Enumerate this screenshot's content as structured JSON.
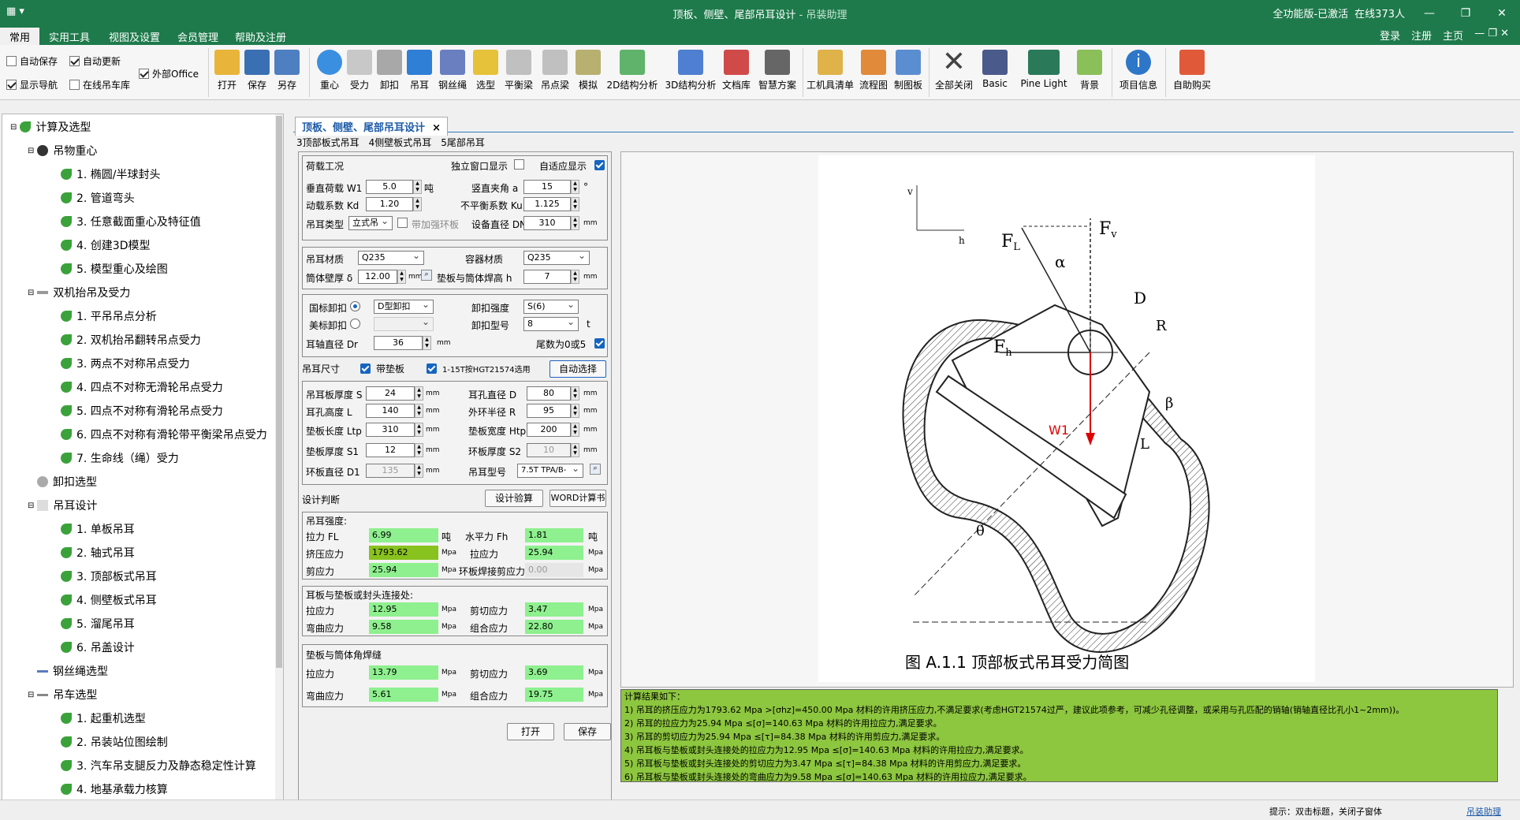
{
  "titlebar": {
    "title": "顶板、侧壁、尾部吊耳设计",
    "app": " - 吊装助理",
    "status": "全功能版-已激活",
    "online": "在线373人"
  },
  "menu": {
    "items": [
      "常用",
      "实用工具",
      "视图及设置",
      "会员管理",
      "帮助及注册"
    ],
    "right": [
      "登录",
      "注册",
      "主页"
    ]
  },
  "ribbon": {
    "checks": [
      {
        "label": "自动保存",
        "on": false
      },
      {
        "label": "自动更新",
        "on": true
      },
      {
        "label": "外部Office",
        "on": true
      },
      {
        "label": "显示导航",
        "on": true
      },
      {
        "label": "在线吊车库",
        "on": false
      }
    ],
    "buttons": [
      "打开",
      "保存",
      "另存",
      "重心",
      "受力",
      "卸扣",
      "吊耳",
      "钢丝绳",
      "选型",
      "平衡梁",
      "吊点梁",
      "模拟",
      "2D结构分析",
      "3D结构分析",
      "文档库",
      "智慧方案",
      "工机具清单",
      "流程图",
      "制图板",
      "全部关闭",
      "Basic",
      "Pine Light",
      "背景",
      "项目信息",
      "自助购买"
    ]
  },
  "tree": {
    "root": "计算及选型",
    "g1": "吊物重心",
    "g1_items": [
      "1. 椭圆/半球封头",
      "2. 管道弯头",
      "3. 任意截面重心及特征值",
      "4. 创建3D模型",
      "5. 模型重心及绘图"
    ],
    "g2": "双机抬吊及受力",
    "g2_items": [
      "1. 平吊吊点分析",
      "2. 双机抬吊翻转吊点受力",
      "3. 两点不对称吊点受力",
      "4. 四点不对称无滑轮吊点受力",
      "5. 四点不对称有滑轮吊点受力",
      "6. 四点不对称有滑轮带平衡梁吊点受力",
      "7. 生命线（绳）受力"
    ],
    "g3": "卸扣选型",
    "g4": "吊耳设计",
    "g4_items": [
      "1. 单板吊耳",
      "2. 轴式吊耳",
      "3. 顶部板式吊耳",
      "4. 侧壁板式吊耳",
      "5. 溜尾吊耳",
      "6. 吊盖设计"
    ],
    "g5": "钢丝绳选型",
    "g6": "吊车选型",
    "g6_items": [
      "1. 起重机选型",
      "2. 吊装站位图绘制",
      "3. 汽车吊支腿反力及静态稳定性计算",
      "4. 地基承载力核算"
    ]
  },
  "doc": {
    "tab": "顶板、侧壁、尾部吊耳设计",
    "subtabs": [
      "3顶部板式吊耳",
      "4侧壁板式吊耳",
      "5尾部吊耳"
    ]
  },
  "form": {
    "load_title": "荷载工况",
    "indep": "独立窗口显示",
    "adapt": "自适应显示",
    "w1_lbl": "垂直荷载 W1",
    "w1": "5.0",
    "w1_unit": "吨",
    "angle_lbl": "竖直夹角 a",
    "angle": "15",
    "angle_unit": "°",
    "kd_lbl": "动载系数 Kd",
    "kd": "1.20",
    "ku_lbl": "不平衡系数 Ku",
    "ku": "1.125",
    "type_lbl": "吊耳类型",
    "type": "立式吊",
    "ring_lbl": "带加强环板",
    "dn_lbl": "设备直径 DN",
    "dn": "310",
    "dn_unit": "mm",
    "mat_lbl": "吊耳材质",
    "mat": "Q235",
    "vmat_lbl": "容器材质",
    "vmat": "Q235",
    "wall_lbl": "筒体壁厚 δ",
    "wall": "12.00",
    "wall_unit": "mm",
    "weld_lbl": "垫板与筒体焊高 h",
    "weld": "7",
    "weld_unit": "mm",
    "gb_lbl": "国标卸扣",
    "gb": "D型卸扣",
    "str_lbl": "卸扣强度",
    "str": "S(6)",
    "us_lbl": "美标卸扣",
    "model_lbl": "卸扣型号",
    "model": "8",
    "model_unit": "t",
    "pin_lbl": "耳轴直径 Dr",
    "pin": "36",
    "pin_unit": "mm",
    "tail_lbl": "尾数为0或5",
    "size_lbl": "吊耳尺寸",
    "pad_lbl": "带垫板",
    "std_lbl": "1-15T按HGT21574选用",
    "auto_btn": "自动选择",
    "s_lbl": "吊耳板厚度 S",
    "s": "24",
    "d_lbl": "耳孔直径 D",
    "d": "80",
    "l_lbl": "耳孔高度 L",
    "l": "140",
    "r_lbl": "外环半径 R",
    "r": "95",
    "ltp_lbl": "垫板长度 Ltp",
    "ltp": "310",
    "htp_lbl": "垫板宽度 Htp",
    "htp": "200",
    "s1_lbl": "垫板厚度 S1",
    "s1": "12",
    "s2_lbl": "环板厚度 S2",
    "s2": "10",
    "d1_lbl": "环板直径 D1",
    "d1": "135",
    "lug_lbl": "吊耳型号",
    "lug": "7.5T TPA/B-",
    "mm": "mm",
    "judge_lbl": "设计判断",
    "calc_btn": "设计验算",
    "word_btn": "WORD计算书",
    "r1_title": "吊耳强度:",
    "fl_lbl": "拉力 FL",
    "fl": "6.99",
    "fl_unit": "吨",
    "fh_lbl": "水平力 Fh",
    "fh": "1.81",
    "fh_unit": "吨",
    "bear_lbl": "挤压应力",
    "bear": "1793.62",
    "ten_lbl": "拉应力",
    "ten": "25.94",
    "sh_lbl": "剪应力",
    "sh": "25.94",
    "ring_sh_lbl": "环板焊接剪应力",
    "ring_sh": "0.00",
    "mpa": "Mpa",
    "r2_title": "耳板与垫板或封头连接处:",
    "r2_ten": "12.95",
    "r2_sh": "3.47",
    "r2_bend": "9.58",
    "r2_comb": "22.80",
    "r3_title": "垫板与筒体角焊缝",
    "r3_ten": "13.79",
    "r3_sh": "3.69",
    "r3_bend": "5.61",
    "r3_comb": "19.75",
    "ten2_lbl": "拉应力",
    "sh2_lbl": "剪切应力",
    "bend_lbl": "弯曲应力",
    "comb_lbl": "组合应力",
    "open_btn": "打开",
    "save_btn": "保存"
  },
  "diagram": {
    "caption": "图 A.1.1  顶部板式吊耳受力简图",
    "w1": "W1",
    "fl": "F",
    "fl_sub": "L",
    "fv": "F",
    "fv_sub": "v",
    "fh": "F",
    "fh_sub": "h",
    "v": "v",
    "h": "h",
    "alpha": "α",
    "beta": "β",
    "theta": "θ",
    "d": "D",
    "r": "R",
    "l": "L"
  },
  "result": {
    "lines": [
      "计算结果如下：",
      "    1) 吊耳的挤压应力为1793.62 Mpa >[σhz]=450.00 Mpa 材料的许用挤压应力,不满足要求(考虑HGT21574过严，建议此项参考，可减少孔径调整，或采用与孔匹配的销轴(销轴直径比孔小1~2mm))。",
      "    2) 吊耳的拉应力为25.94 Mpa ≤[σ]=140.63 Mpa 材料的许用拉应力,满足要求。",
      "    3) 吊耳的剪切应力为25.94 Mpa ≤[τ]=84.38 Mpa 材料的许用剪应力,满足要求。",
      "    4) 吊耳板与垫板或封头连接处的拉应力为12.95 Mpa ≤[σ]=140.63 Mpa 材料的许用拉应力,满足要求。",
      "    5) 吊耳板与垫板或封头连接处的剪切应力为3.47 Mpa ≤[τ]=84.38 Mpa 材料的许用剪应力,满足要求。",
      "    6) 吊耳板与垫板或封头连接处的弯曲应力为9.58 Mpa ≤[σ]=140.63 Mpa 材料的许用拉应力,满足要求。"
    ]
  },
  "status": {
    "hint": "提示：双击标题，关闭子窗体",
    "link": "吊装助理"
  },
  "colors": {
    "title": "#1e7a4b",
    "ok": "#8ef08e",
    "bad": "#88c21e",
    "result": "#8dc63f",
    "link": "#1c5aa8"
  }
}
